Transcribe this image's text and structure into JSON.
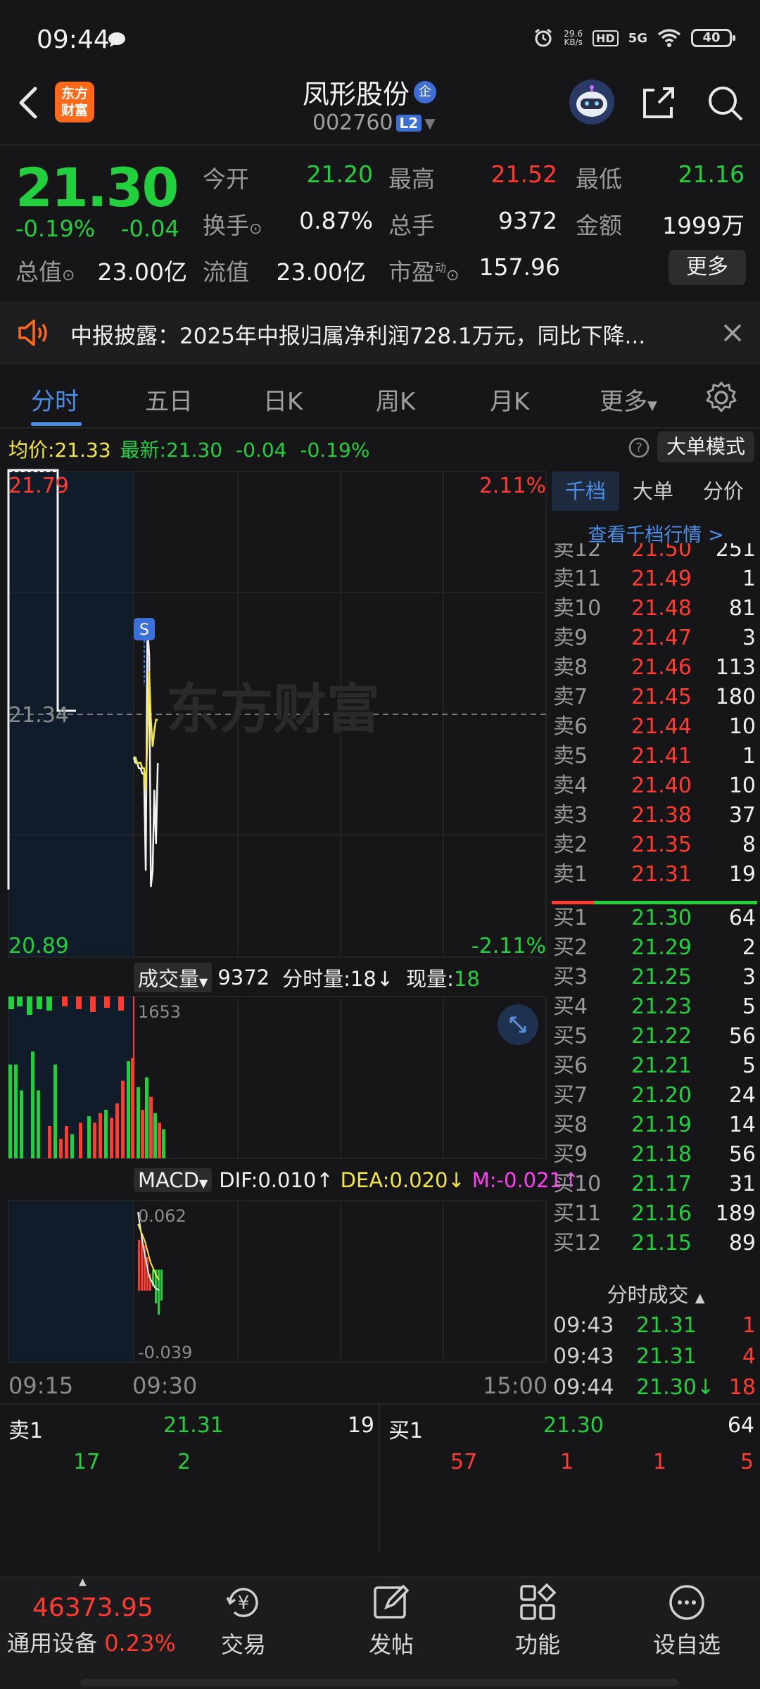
{
  "status": {
    "time": "09:44",
    "net_speed_value": "29.6",
    "net_speed_unit": "KB/s",
    "hd": "HD",
    "signal": "5G",
    "battery": "40"
  },
  "header": {
    "logo_line1": "东方",
    "logo_line2": "财富",
    "stock_name": "凤形股份",
    "badge": "企",
    "code": "002760",
    "level": "L2"
  },
  "quote": {
    "price": "21.30",
    "change_pct": "-0.19%",
    "change_abs": "-0.04",
    "open_label": "今开",
    "open": "21.20",
    "high_label": "最高",
    "high": "21.52",
    "low_label": "最低",
    "low": "21.16",
    "turnover_label": "换手",
    "turnover": "0.87%",
    "volume_label": "总手",
    "volume": "9372",
    "amount_label": "金额",
    "amount": "1999万",
    "mktcap_label": "总值",
    "mktcap": "23.00亿",
    "float_label": "流值",
    "float": "23.00亿",
    "pe_label": "市盈",
    "pe_sup": "动",
    "pe": "157.96",
    "more_label": "更多"
  },
  "announcement": {
    "text": "中报披露：2025年中报归属净利润728.1万元，同比下降..."
  },
  "tabs": [
    "分时",
    "五日",
    "日K",
    "周K",
    "月K",
    "更多"
  ],
  "chart_header": {
    "avg_label": "均价:",
    "avg": "21.33",
    "latest_label": "最新:",
    "latest": "21.30",
    "chg_abs": "-0.04",
    "chg_pct": "-0.19%",
    "mode_button": "大单模式"
  },
  "chart_labels": {
    "price_top": "21.79",
    "price_mid": "21.34",
    "price_bottom": "20.89",
    "pct_top": "2.11%",
    "pct_bottom": "-2.11%",
    "signal_marker": "S",
    "watermark": "东方财富",
    "vol_selector": "成交量",
    "vol_total": "9372",
    "vol_minute_label": "分时量:",
    "vol_minute": "18↓",
    "vol_now_label": "现量:",
    "vol_now": "18",
    "vol_max": "1653",
    "macd_selector": "MACD",
    "dif": "DIF:0.010↑",
    "dea": "DEA:0.020↓",
    "m": "M:-0.021↑",
    "macd_top": "0.062",
    "macd_bottom": "-0.039",
    "time_start": "09:15",
    "time_mid": "09:30",
    "time_end": "15:00"
  },
  "chart_data": {
    "type": "line",
    "x": [
      "09:15",
      "09:25",
      "09:30",
      "09:31",
      "09:32",
      "09:33",
      "09:34",
      "09:35",
      "09:36",
      "09:37",
      "09:38",
      "09:39",
      "09:40",
      "09:41",
      "09:42",
      "09:43",
      "09:44"
    ],
    "series": [
      {
        "values": [
          20.92,
          21.26,
          21.26,
          21.25,
          21.25,
          21.24,
          21.24,
          21.23,
          21.23,
          21.05,
          21.5,
          21.45,
          21.02,
          21.05,
          21.2,
          21.1,
          21.25
        ]
      },
      {
        "values": [
          20.92,
          21.26,
          21.26,
          21.26,
          21.25,
          21.25,
          21.25,
          21.24,
          21.24,
          21.2,
          21.3,
          21.42,
          21.33,
          21.28,
          21.31,
          21.33,
          21.33
        ]
      }
    ],
    "ylim": [
      20.89,
      21.79
    ],
    "reference": 21.34,
    "volume_max": 1653,
    "macd_range": [
      -0.039,
      0.062
    ]
  },
  "order_book": {
    "tabs": [
      "千档",
      "大单",
      "分价"
    ],
    "link": "查看千档行情 >",
    "asks": [
      {
        "label": "卖12",
        "price": "21.50",
        "vol": "251"
      },
      {
        "label": "卖11",
        "price": "21.49",
        "vol": "1"
      },
      {
        "label": "卖10",
        "price": "21.48",
        "vol": "81"
      },
      {
        "label": "卖9",
        "price": "21.47",
        "vol": "3"
      },
      {
        "label": "卖8",
        "price": "21.46",
        "vol": "113"
      },
      {
        "label": "卖7",
        "price": "21.45",
        "vol": "180"
      },
      {
        "label": "卖6",
        "price": "21.44",
        "vol": "10"
      },
      {
        "label": "卖5",
        "price": "21.41",
        "vol": "1"
      },
      {
        "label": "卖4",
        "price": "21.40",
        "vol": "10"
      },
      {
        "label": "卖3",
        "price": "21.38",
        "vol": "37"
      },
      {
        "label": "卖2",
        "price": "21.35",
        "vol": "8"
      },
      {
        "label": "卖1",
        "price": "21.31",
        "vol": "19"
      }
    ],
    "bids": [
      {
        "label": "买1",
        "price": "21.30",
        "vol": "64"
      },
      {
        "label": "买2",
        "price": "21.29",
        "vol": "2"
      },
      {
        "label": "买3",
        "price": "21.25",
        "vol": "3"
      },
      {
        "label": "买4",
        "price": "21.23",
        "vol": "5"
      },
      {
        "label": "买5",
        "price": "21.22",
        "vol": "56"
      },
      {
        "label": "买6",
        "price": "21.21",
        "vol": "5"
      },
      {
        "label": "买7",
        "price": "21.20",
        "vol": "24"
      },
      {
        "label": "买8",
        "price": "21.19",
        "vol": "14"
      },
      {
        "label": "买9",
        "price": "21.18",
        "vol": "56"
      },
      {
        "label": "买10",
        "price": "21.17",
        "vol": "31"
      },
      {
        "label": "买11",
        "price": "21.16",
        "vol": "189"
      },
      {
        "label": "买12",
        "price": "21.15",
        "vol": "89"
      }
    ],
    "trades_title": "分时成交",
    "trades": [
      {
        "time": "09:43",
        "price": "21.31",
        "vol": "1"
      },
      {
        "time": "09:43",
        "price": "21.31",
        "vol": "4"
      },
      {
        "time": "09:44",
        "price": "21.30↓",
        "vol": "18"
      }
    ]
  },
  "queue": {
    "sell_label": "卖1",
    "sell_price": "21.31",
    "sell_total": "19",
    "buy_label": "买1",
    "buy_price": "21.30",
    "buy_total": "64",
    "sell_orders": [
      "17",
      "2"
    ],
    "buy_orders": [
      "57",
      "1",
      "1",
      "5"
    ]
  },
  "bottom_nav": {
    "index_value": "46373.95",
    "index_name": "通用设备",
    "index_pct": "0.23%",
    "items": [
      "交易",
      "发帖",
      "功能",
      "设自选"
    ],
    "trade_glyph": "¥"
  },
  "colors": {
    "up": "#ff3b30",
    "down": "#22d03e",
    "accent": "#4a8fe8",
    "background": "#161618"
  }
}
